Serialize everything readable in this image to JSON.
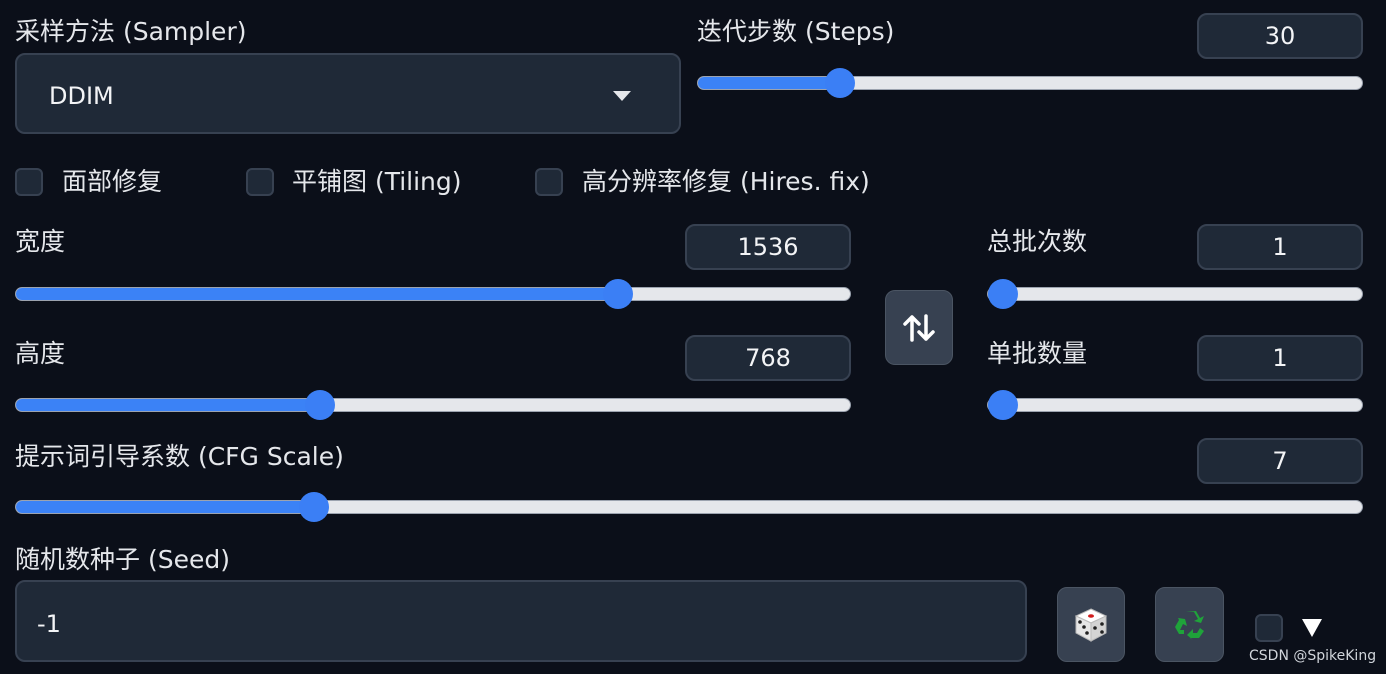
{
  "sampler": {
    "label": "采样方法 (Sampler)",
    "value": "DDIM"
  },
  "steps": {
    "label": "迭代步数 (Steps)",
    "value": "30",
    "level": 0.2
  },
  "checkboxes": [
    {
      "label": "面部修复",
      "checked": false
    },
    {
      "label": "平铺图 (Tiling)",
      "checked": false
    },
    {
      "label": "高分辨率修复 (Hires. fix)",
      "checked": false
    }
  ],
  "width": {
    "label": "宽度",
    "value": "1536",
    "level": 0.73
  },
  "height": {
    "label": "高度",
    "value": "768",
    "level": 0.36
  },
  "batch_count": {
    "label": "总批次数",
    "value": "1",
    "level": 0.0
  },
  "batch_size": {
    "label": "单批数量",
    "value": "1",
    "level": 0.0
  },
  "cfg": {
    "label": "提示词引导系数 (CFG Scale)",
    "value": "7",
    "level": 0.215
  },
  "seed": {
    "label": "随机数种子 (Seed)",
    "value": "-1"
  },
  "icons": {
    "swap": "swap-arrows-icon",
    "dice": "dice-icon",
    "recycle": "recycle-icon",
    "expand": "triangle-down-icon"
  },
  "colors": {
    "background": "#0b0f19",
    "accent": "#3b82f6",
    "input_bg": "#1f2937"
  },
  "watermark": "CSDN @SpikeKing"
}
